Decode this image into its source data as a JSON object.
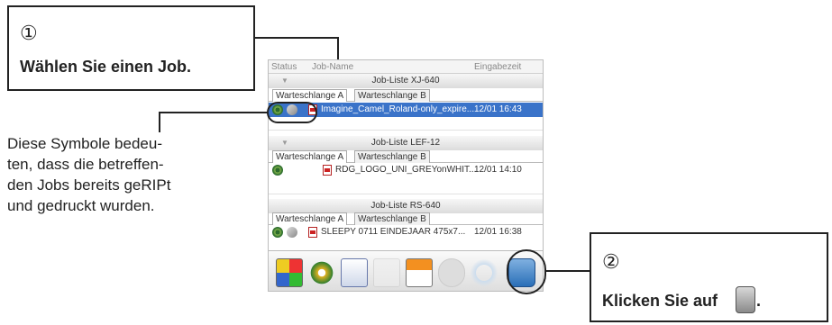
{
  "callout_select": {
    "step": "①",
    "text": "Wählen Sie einen Job."
  },
  "callout_delete": {
    "step": "②",
    "text": "Klicken Sie auf",
    "icon": "trash-icon",
    "suffix": "."
  },
  "status_description": "Diese Symbole bedeu-\nten, dass die betreffen-\nden Jobs bereits geRIPt\nund gedruckt wurden.",
  "header": {
    "status": "Status",
    "job_name": "Job-Name",
    "received": "Eingabezeit"
  },
  "queues": [
    {
      "title": "Job-Liste XJ-640",
      "tabs": [
        "Warteschlange A",
        "Warteschlange B"
      ],
      "jobs": [
        {
          "name": "Imagine_Camel_Roland-only_expire...",
          "time": "12/01 16:43",
          "selected": true
        }
      ]
    },
    {
      "title": "Job-Liste LEF-12",
      "tabs": [
        "Warteschlange A",
        "Warteschlange B"
      ],
      "jobs": [
        {
          "name": "RDG_LOGO_UNI_GREYonWHIT...",
          "time": "12/01 14:10",
          "selected": false
        }
      ]
    },
    {
      "title": "Job-Liste RS-640",
      "tabs": [
        "Warteschlange A",
        "Warteschlange B"
      ],
      "jobs": [
        {
          "name": "SLEEPY 0711 EINDEJAAR 475x7...",
          "time": "12/01 16:38",
          "selected": false
        }
      ]
    }
  ],
  "toolbar": [
    "color-management-icon",
    "settings-gear-icon",
    "job-settings-icon",
    "layout-icon",
    "print-icon",
    "cancel-icon",
    "progress-icon",
    "trash-icon"
  ],
  "colors": {
    "selection": "#3a73c9",
    "callout_border": "#222222"
  }
}
